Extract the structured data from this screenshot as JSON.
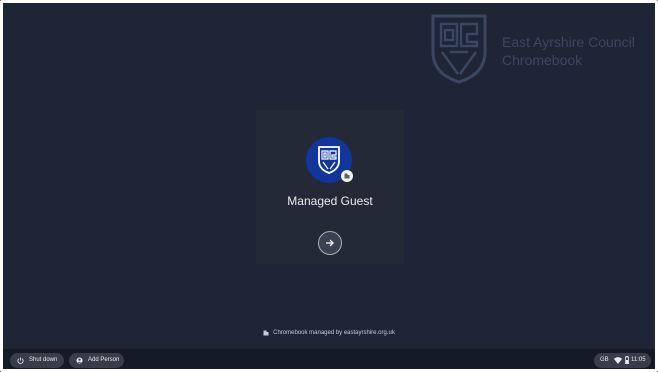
{
  "branding": {
    "organization_line1": "East Ayrshire Council",
    "organization_line2": "Chromebook"
  },
  "user_pod": {
    "name": "Managed Guest",
    "next_icon": "arrow-right-icon",
    "avatar_color": "#12359c"
  },
  "footer": {
    "managed_notice": "Chromebook managed by eastayrshire.org.uk"
  },
  "shelf": {
    "shutdown_label": "Shut down",
    "add_person_label": "Add Person",
    "keyboard_layout": "GB",
    "time": "11:05"
  },
  "colors": {
    "background": "#1d2536",
    "card": "#242a35",
    "shelf": "#151b26",
    "pill": "#373d49"
  }
}
